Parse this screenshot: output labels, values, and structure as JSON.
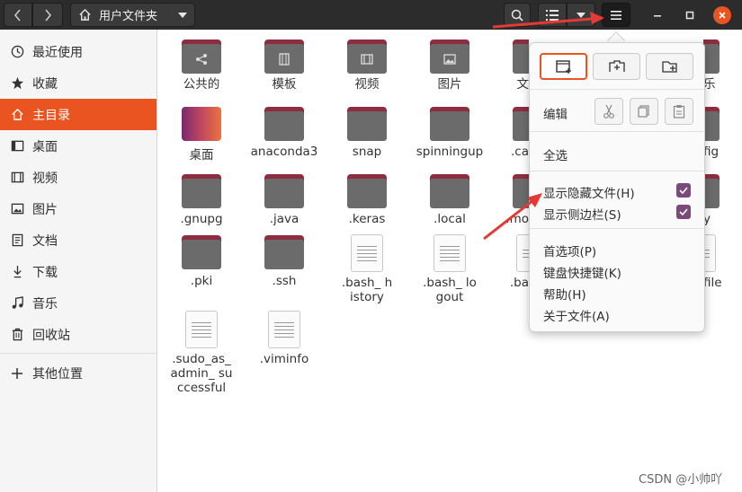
{
  "header": {
    "path_label": "用户文件夹",
    "icons": [
      "chevron-left-icon",
      "chevron-right-icon",
      "home-icon",
      "caret-down-icon",
      "search-icon",
      "list-view-icon",
      "caret-down-icon",
      "hamburger-menu-icon",
      "minimize-icon",
      "maximize-icon",
      "close-icon"
    ]
  },
  "sidebar": {
    "items": [
      {
        "label": "最近使用",
        "icon": "clock-icon"
      },
      {
        "label": "收藏",
        "icon": "star-icon"
      },
      {
        "label": "主目录",
        "icon": "home-icon",
        "active": true
      },
      {
        "label": "桌面",
        "icon": "desktop-icon"
      },
      {
        "label": "视频",
        "icon": "film-icon"
      },
      {
        "label": "图片",
        "icon": "image-icon"
      },
      {
        "label": "文档",
        "icon": "document-icon"
      },
      {
        "label": "下载",
        "icon": "download-icon"
      },
      {
        "label": "音乐",
        "icon": "music-icon"
      },
      {
        "label": "回收站",
        "icon": "trash-icon"
      }
    ],
    "other_label": "其他位置"
  },
  "files": [
    {
      "label": "公共的",
      "kind": "folder",
      "glyph": "share"
    },
    {
      "label": "模板",
      "kind": "folder",
      "glyph": "template"
    },
    {
      "label": "视频",
      "kind": "folder",
      "glyph": "film"
    },
    {
      "label": "图片",
      "kind": "folder",
      "glyph": "image"
    },
    {
      "label": "桌面",
      "kind": "desktop"
    },
    {
      "label": "anaconda3",
      "kind": "folder"
    },
    {
      "label": "snap",
      "kind": "folder"
    },
    {
      "label": "spinningup",
      "kind": "folder"
    },
    {
      "label": ".gnupg",
      "kind": "folder"
    },
    {
      "label": ".java",
      "kind": "folder"
    },
    {
      "label": ".keras",
      "kind": "folder"
    },
    {
      "label": ".local",
      "kind": "folder"
    },
    {
      "label": ".pki",
      "kind": "folder"
    },
    {
      "label": ".ssh",
      "kind": "folder"
    },
    {
      "label": ".bash_ history",
      "kind": "doc"
    },
    {
      "label": ".bash_ logout",
      "kind": "doc"
    },
    {
      "label": ".sudo_as_ admin_ successful",
      "kind": "doc"
    },
    {
      "label": ".viminfo",
      "kind": "doc"
    }
  ],
  "partial_labels": {
    "col5_row1": "文",
    "col5_row2": ".ca",
    "col5_row3": ".mo",
    "col5_row4": ".ba",
    "col6_row1": "乐",
    "col6_row2": "fig",
    "col6_row3": "y",
    "col6_row4": "file"
  },
  "menu": {
    "edit_label": "编辑",
    "select_all": "全选",
    "show_hidden": "显示隐藏文件(H)",
    "show_sidebar": "显示侧边栏(S)",
    "preferences": "首选项(P)",
    "shortcuts": "键盘快捷键(K)",
    "help": "帮助(H)",
    "about": "关于文件(A)",
    "show_hidden_checked": true,
    "show_sidebar_checked": true
  },
  "watermark": "CSDN @小帅吖",
  "colors": {
    "accent": "#e95420",
    "folder_tab": "#8e2d3f",
    "folder_body": "#6b6b6b",
    "check": "#7a4a7a",
    "arrow": "#e53935"
  }
}
